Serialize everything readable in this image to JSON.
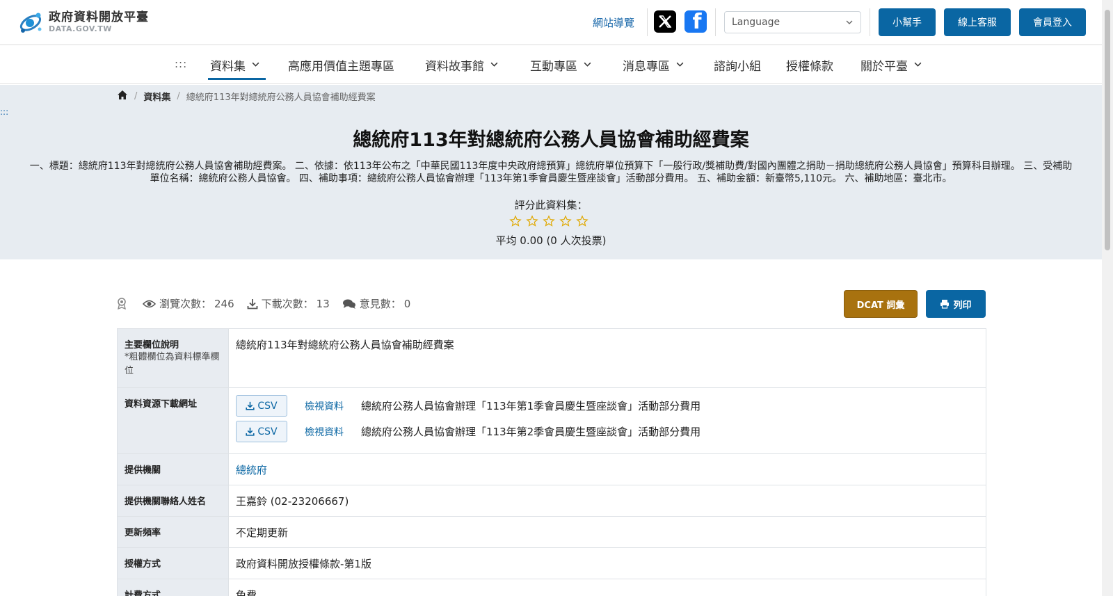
{
  "header": {
    "logo_title": "政府資料開放平臺",
    "logo_sub": "DATA.GOV.TW",
    "sitemap": "網站導覽",
    "language_placeholder": "Language",
    "buttons": [
      "小幫手",
      "線上客服",
      "會員登入"
    ]
  },
  "nav": {
    "dots": ":::",
    "items": [
      "資料集",
      "高應用價值主題專區",
      "資料故事館",
      "互動專區",
      "消息專區",
      "諮詢小組",
      "授權條款",
      "關於平臺"
    ],
    "active": "資料集"
  },
  "breadcrumb": {
    "items": [
      "資料集",
      "總統府113年對總統府公務人員協會補助經費案"
    ]
  },
  "hero": {
    "dots": ":::",
    "title": "總統府113年對總統府公務人員協會補助經費案",
    "description": "一、標題：總統府113年對總統府公務人員協會補助經費案。 二、依據：依113年公布之「中華民國113年度中央政府總預算」總統府單位預算下「一般行政/獎補助費/對國內團體之捐助－捐助總統府公務人員協會」預算科目辦理。 三、受補助單位名稱：總統府公務人員協會。 四、補助事項：總統府公務人員協會辦理「113年第1季會員慶生暨座談會」活動部分費用。 五、補助金額：新臺幣5,110元。 六、補助地區：臺北市。",
    "rate_label": "評分此資料集：",
    "rating": 0,
    "max_rating": 5,
    "average": "平均 0.00 (0 人次投票)"
  },
  "stats": {
    "views_label": "瀏覽次數：",
    "views": "246",
    "downloads_label": "下載次數：",
    "downloads": "13",
    "comments_label": "意見數：",
    "comments": "0"
  },
  "actions": {
    "dcat": "DCAT 詞彙",
    "print": "列印"
  },
  "table": {
    "main_field_label": "主要欄位說明",
    "main_field_note": "*粗體欄位為資料標準欄位",
    "main_field_value": "總統府113年對總統府公務人員協會補助經費案",
    "resources_label": "資料資源下載網址",
    "resources": [
      {
        "format": "CSV",
        "view": "檢視資料",
        "desc": "總統府公務人員協會辦理「113年第1季會員慶生暨座談會」活動部分費用"
      },
      {
        "format": "CSV",
        "view": "檢視資料",
        "desc": "總統府公務人員協會辦理「113年第2季會員慶生暨座談會」活動部分費用"
      }
    ],
    "provider_label": "提供機關",
    "provider_value": "總統府",
    "contact_label": "提供機關聯絡人姓名",
    "contact_value": "王嘉鈴 (02-23206667)",
    "frequency_label": "更新頻率",
    "frequency_value": "不定期更新",
    "license_label": "授權方式",
    "license_value": "政府資料開放授權條款-第1版",
    "fee_label": "計費方式",
    "fee_value": "免費"
  },
  "colors": {
    "primary": "#0a66a3",
    "dcat": "#a8720f",
    "hero_bg": "#e7ecf1",
    "star": "#e0a800"
  }
}
